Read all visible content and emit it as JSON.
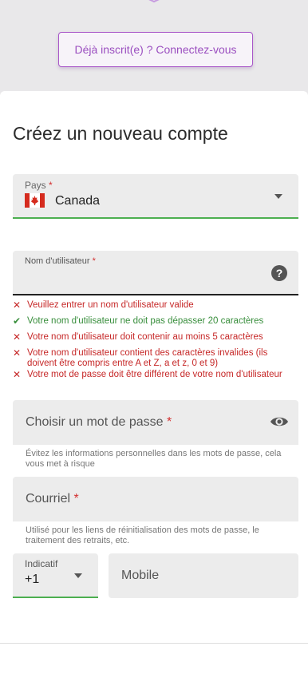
{
  "header": {
    "login_button": "Déjà inscrit(e) ? Connectez-vous"
  },
  "form": {
    "title": "Créez un nouveau compte",
    "country": {
      "label": "Pays",
      "required_mark": "*",
      "value": "Canada",
      "flag_icon": "canada-flag-icon"
    },
    "username": {
      "label": "Nom d'utilisateur",
      "required_mark": "*",
      "help_icon": "question-mark-icon",
      "rules": [
        {
          "status": "invalid",
          "text": "Veuillez entrer un nom d'utilisateur valide"
        },
        {
          "status": "valid",
          "text": "Votre nom d'utilisateur ne doit pas dépasser 20 caractères"
        },
        {
          "status": "invalid",
          "text": "Votre nom d'utilisateur doit contenir au moins 5 caractères"
        },
        {
          "status": "invalid",
          "text": "Votre nom d'utilisateur contient des caractères invalides (ils doivent être compris entre A et Z, a et z, 0 et 9)"
        },
        {
          "status": "invalid",
          "text": "Votre mot de passe doit être différent de votre nom d'utilisateur"
        }
      ]
    },
    "password": {
      "placeholder": "Choisir un mot de passe",
      "required_mark": "*",
      "hint": "Évitez les informations personnelles dans les mots de passe, cela vous met à risque"
    },
    "email": {
      "placeholder": "Courriel",
      "required_mark": "*",
      "hint": "Utilisé pour les liens de réinitialisation des mots de passe, le traitement des retraits, etc."
    },
    "phone": {
      "prefix_label": "Indicatif",
      "prefix_value": "+1",
      "mobile_placeholder": "Mobile"
    }
  },
  "colors": {
    "accent": "#a957c9",
    "valid": "#388e3c",
    "invalid": "#c62828",
    "focus_line": "#4caf50"
  }
}
